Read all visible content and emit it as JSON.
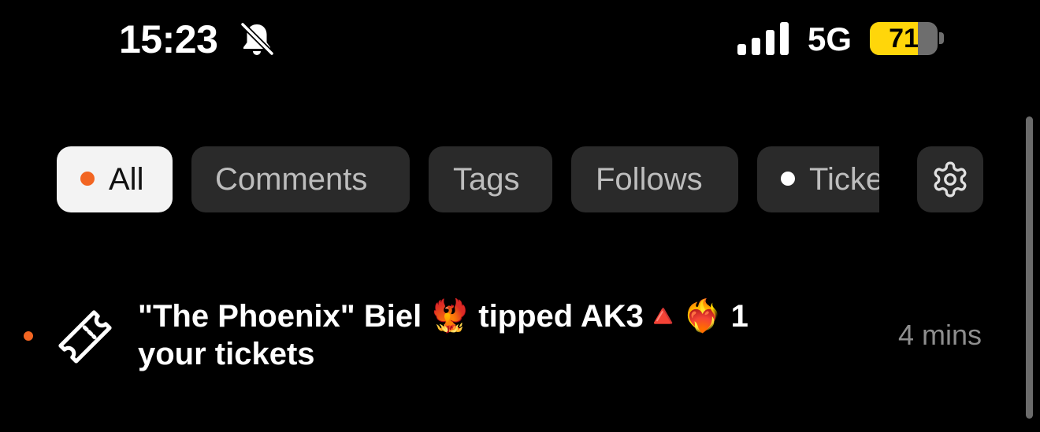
{
  "status_bar": {
    "time": "15:23",
    "silent_icon": "bell-slash-icon",
    "signal_icon": "cellular-signal-icon",
    "network": "5G",
    "battery_percent": 71,
    "battery_label": "71",
    "battery_color": "#ffd60a"
  },
  "filters": {
    "tabs": [
      {
        "label": "All",
        "active": true,
        "has_dot": true,
        "dot_color": "#f26522"
      },
      {
        "label": "Comments",
        "active": false,
        "has_dot": false
      },
      {
        "label": "Tags",
        "active": false,
        "has_dot": false
      },
      {
        "label": "Follows",
        "active": false,
        "has_dot": false
      },
      {
        "label": "Tickets",
        "active": false,
        "has_dot": true,
        "dot_color": "#ffffff"
      }
    ],
    "settings_icon": "gear-icon"
  },
  "notifications": [
    {
      "unread": true,
      "unread_color": "#f26522",
      "icon": "ticket-icon",
      "text": "\"The Phoenix\" Biel 🐦‍🔥 tipped AK3🔺❤️‍🔥 1 your tickets",
      "time": "4 mins"
    }
  ],
  "colors": {
    "background": "#000000",
    "accent": "#f26522",
    "chip_background": "#2a2a2a",
    "chip_active_background": "#f3f3f3"
  }
}
